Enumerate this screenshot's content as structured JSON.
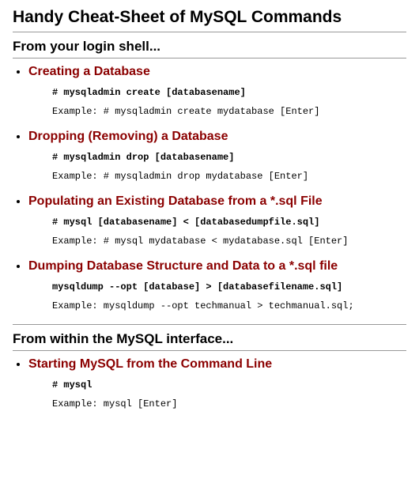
{
  "title": "Handy Cheat-Sheet of MySQL Commands",
  "section1": {
    "heading": "From your login shell...",
    "items": [
      {
        "topic": "Creating a Database",
        "cmd": "# mysqladmin create [databasename]",
        "example": "Example: # mysqladmin create mydatabase [Enter]"
      },
      {
        "topic": "Dropping (Removing) a Database",
        "cmd": "# mysqladmin drop [databasename]",
        "example": "Example: # mysqladmin drop mydatabase [Enter]"
      },
      {
        "topic": "Populating an Existing Database from a *.sql File",
        "cmd": "# mysql [databasename] < [databasedumpfile.sql]",
        "example": "Example: # mysql mydatabase < mydatabase.sql [Enter]"
      },
      {
        "topic": "Dumping Database Structure and Data to a *.sql file",
        "cmd": "mysqldump --opt [database] > [databasefilename.sql]",
        "example": "Example:  mysqldump --opt techmanual > techmanual.sql;"
      }
    ]
  },
  "section2": {
    "heading": "From within the MySQL interface...",
    "items": [
      {
        "topic": "Starting MySQL from the Command Line",
        "cmd": "# mysql",
        "example": "Example:  mysql [Enter]"
      }
    ]
  }
}
